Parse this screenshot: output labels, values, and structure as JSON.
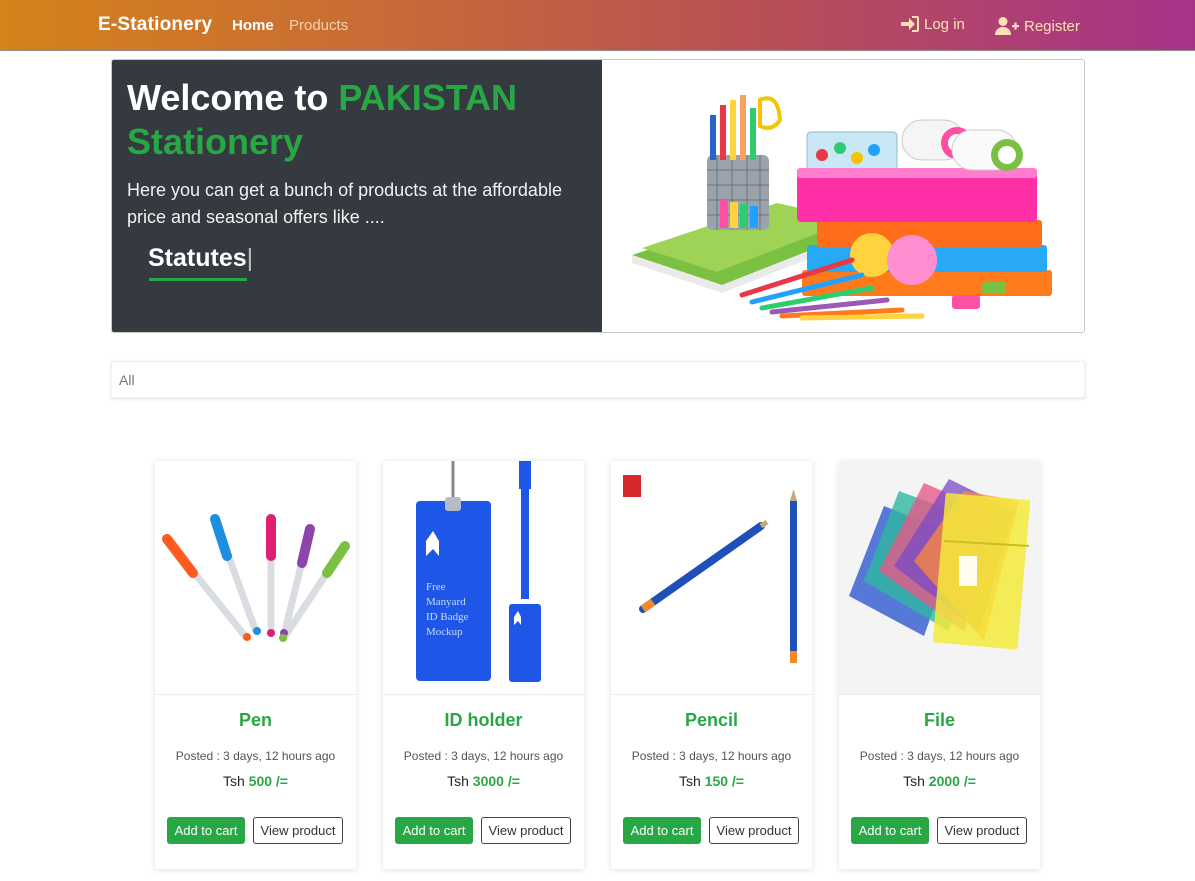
{
  "navbar": {
    "brand": "E-Stationery",
    "links": [
      {
        "label": "Home"
      },
      {
        "label": "Products"
      }
    ],
    "login_label": "Log in",
    "register_label": "Register",
    "login_icon": "sign-in-icon",
    "register_icon": "user-plus-icon"
  },
  "hero": {
    "title_prefix": "Welcome to ",
    "title_accent_1": "PAKISTAN",
    "title_accent_2": "Stationery",
    "description": "Here you can get a bunch of products at the affordable price and seasonal offers like ....",
    "typed_text": "Statutes",
    "cursor": "|",
    "image": "stationery-collection-image"
  },
  "filter": {
    "label": "All"
  },
  "products": [
    {
      "name": "Pen",
      "posted": "Posted : 3 days, 12 hours ago",
      "currency": "Tsh",
      "price": "500",
      "price_suffix": "/=",
      "add_label": "Add to cart",
      "view_label": "View product",
      "image": "pens-image"
    },
    {
      "name": "ID holder",
      "posted": "Posted : 3 days, 12 hours ago",
      "currency": "Tsh",
      "price": "3000",
      "price_suffix": "/=",
      "add_label": "Add to cart",
      "view_label": "View product",
      "image": "id-badge-image"
    },
    {
      "name": "Pencil",
      "posted": "Posted : 3 days, 12 hours ago",
      "currency": "Tsh",
      "price": "150",
      "price_suffix": "/=",
      "add_label": "Add to cart",
      "view_label": "View product",
      "image": "pencils-image"
    },
    {
      "name": "File",
      "posted": "Posted : 3 days, 12 hours ago",
      "currency": "Tsh",
      "price": "2000",
      "price_suffix": "/=",
      "add_label": "Add to cart",
      "view_label": "View product",
      "image": "file-folders-image"
    }
  ],
  "id_badge_mock_text": [
    "Free",
    "Manyard",
    "ID Badge",
    "Mockup"
  ],
  "colors": {
    "accent_green": "#28a745",
    "hero_dark": "#343a40",
    "nav_gradient_start": "#d4821a",
    "nav_gradient_end": "#a6338a"
  }
}
